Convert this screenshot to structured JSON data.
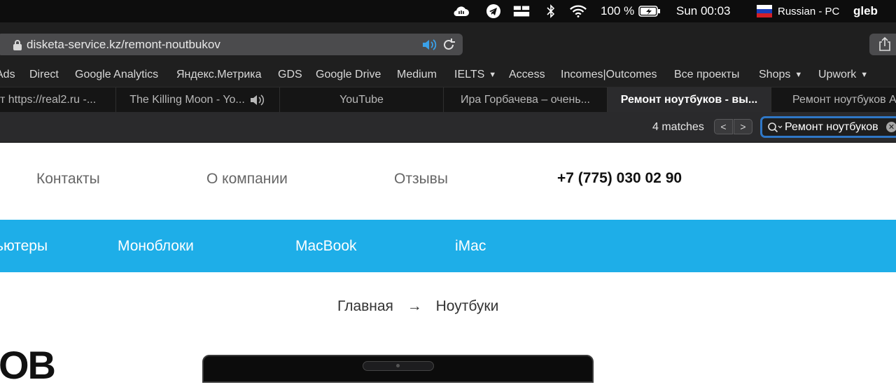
{
  "menubar": {
    "battery": "100 %",
    "clock": "Sun 00:03",
    "input_source": "Russian - PC",
    "user": "gleb"
  },
  "toolbar": {
    "url": "disketa-service.kz/remont-noutbukov"
  },
  "bookmarks": [
    "Ads",
    "Direct",
    "Google Analytics",
    "Яндекс.Метрика",
    "GDS",
    "Google Drive",
    "Medium",
    "IELTS",
    "Access",
    "Incomes|Outcomes",
    "Все проекты",
    "Shops",
    "Upwork"
  ],
  "tabs": [
    "т https://real2.ru -...",
    "The Killing Moon - Yo...",
    "YouTube",
    "Ира Горбачева – очень...",
    "Ремонт ноутбуков - вы...",
    "Ремонт ноутбуков A"
  ],
  "findbar": {
    "matches": "4 matches",
    "query": "Ремонт ноутбуков"
  },
  "page": {
    "nav": [
      "Контакты",
      "О компании",
      "Отзывы"
    ],
    "phone": "+7 (775) 030 02 90",
    "categories": [
      "ьютеры",
      "Моноблоки",
      "MacBook",
      "iMac"
    ],
    "breadcrumb": [
      "Главная",
      "→",
      "Ноутбуки"
    ],
    "heading_fragment": "OB"
  },
  "colors": {
    "accent_blue": "#1eaee8",
    "find_focus": "#2f77c6"
  }
}
